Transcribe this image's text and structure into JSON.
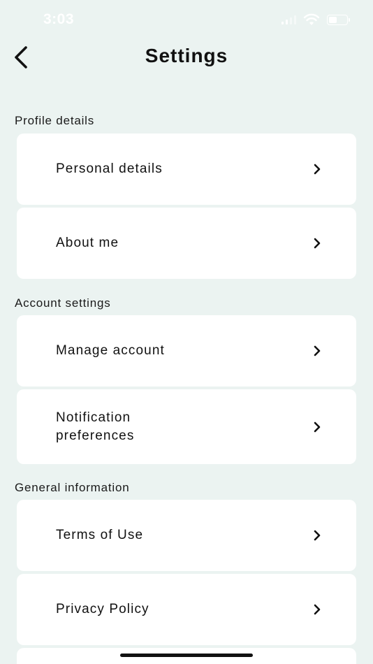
{
  "status_bar": {
    "time": "3:03",
    "icons": [
      "signal-icon",
      "wifi-icon",
      "battery-icon"
    ]
  },
  "header": {
    "title": "Settings",
    "back_icon": "chevron-left-icon"
  },
  "sections": [
    {
      "label": "Profile details",
      "items": [
        {
          "label": "Personal details"
        },
        {
          "label": "About me"
        }
      ]
    },
    {
      "label": "Account settings",
      "items": [
        {
          "label": "Manage account"
        },
        {
          "label": "Notification preferences"
        }
      ]
    },
    {
      "label": "General information",
      "items": [
        {
          "label": "Terms of Use"
        },
        {
          "label": "Privacy Policy"
        }
      ]
    }
  ],
  "colors": {
    "background": "#ebf3f1",
    "card": "#ffffff",
    "text": "#111111"
  }
}
